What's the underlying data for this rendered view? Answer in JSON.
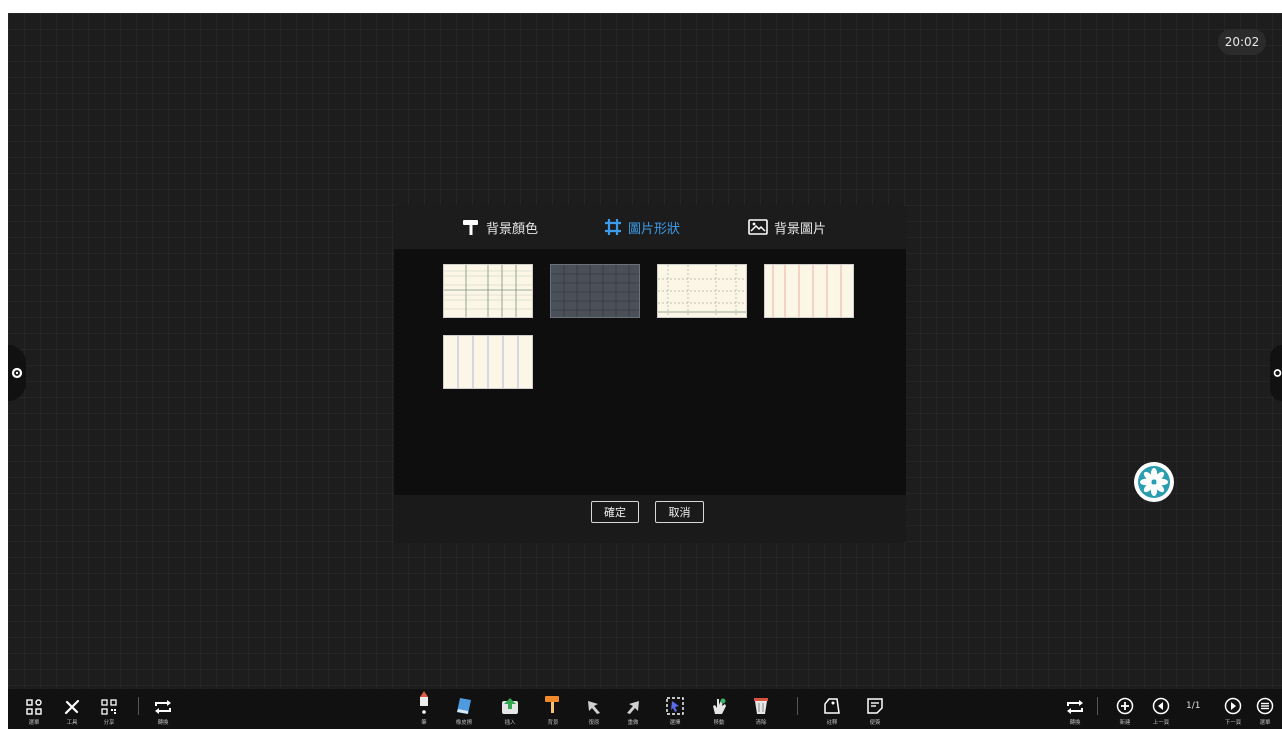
{
  "status": {
    "clock": "20:02"
  },
  "dialog": {
    "tabs": [
      {
        "label": "背景顏色",
        "icon": "paint-roller-icon",
        "active": false
      },
      {
        "label": "圖片形狀",
        "icon": "grid-crop-icon",
        "active": true
      },
      {
        "label": "背景圖片",
        "icon": "image-icon",
        "active": false
      }
    ],
    "ok_label": "確定",
    "cancel_label": "取消",
    "accent_color": "#3d9be9",
    "patterns": [
      {
        "name": "square-grid-cream",
        "background": "#fbf6e6",
        "line": "#8a9a8a"
      },
      {
        "name": "square-grid-slate",
        "background": "#4a5058",
        "line": "#2b2f35"
      },
      {
        "name": "dashed-grid-cream",
        "background": "#fbf6e6",
        "line": "#9aa69a"
      },
      {
        "name": "red-columns-cream",
        "background": "#fbf6e6",
        "line": "#e9a9a0"
      },
      {
        "name": "blue-columns-cream",
        "background": "#fbf6e6",
        "line": "#a8b4d8"
      }
    ]
  },
  "toolbar": {
    "left": [
      {
        "label": "選單",
        "icon": "apps-icon"
      },
      {
        "label": "工具",
        "icon": "tools-icon"
      },
      {
        "label": "分享",
        "icon": "qr-code-icon"
      },
      {
        "label": "轉換",
        "icon": "switch-icon"
      }
    ],
    "center": [
      {
        "label": "筆",
        "icon": "pen-icon"
      },
      {
        "label": "橡皮擦",
        "icon": "eraser-icon"
      },
      {
        "label": "插入",
        "icon": "insert-icon"
      },
      {
        "label": "背景",
        "icon": "background-roller-icon"
      },
      {
        "label": "復原",
        "icon": "undo-icon"
      },
      {
        "label": "重做",
        "icon": "redo-icon"
      },
      {
        "label": "選擇",
        "icon": "select-icon"
      },
      {
        "label": "移動",
        "icon": "move-hand-icon"
      },
      {
        "label": "清除",
        "icon": "clear-trash-icon"
      },
      {
        "label": "註釋",
        "icon": "annotation-icon"
      },
      {
        "label": "便簽",
        "icon": "sticky-note-icon"
      }
    ],
    "right": [
      {
        "label": "轉換",
        "icon": "switch-icon"
      },
      {
        "label": "新建",
        "icon": "new-page-icon"
      },
      {
        "label": "上一頁",
        "icon": "prev-page-icon"
      },
      {
        "label": "下一頁",
        "icon": "next-page-icon"
      },
      {
        "label": "選單",
        "icon": "menu-icon"
      }
    ],
    "page_counter": "1/1"
  }
}
